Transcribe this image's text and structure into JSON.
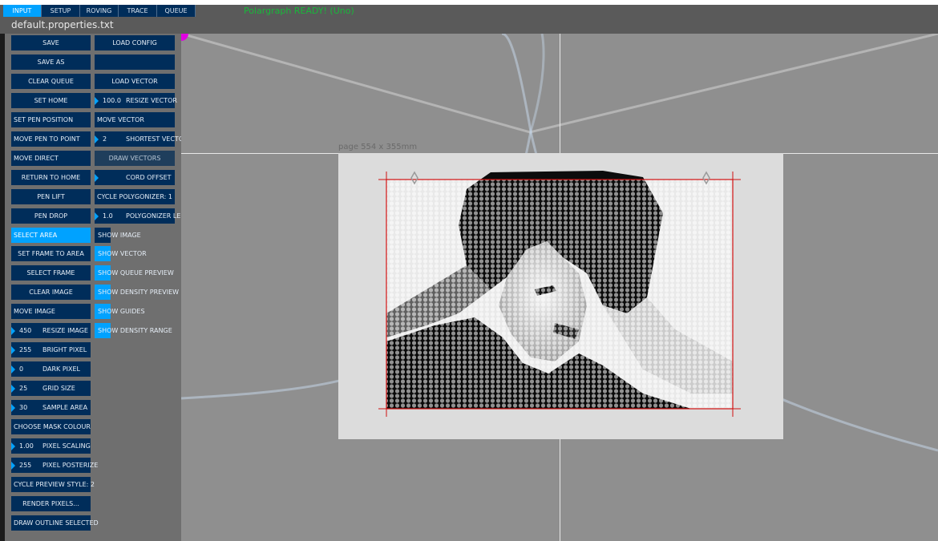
{
  "tabs": [
    {
      "label": "INPUT",
      "active": true
    },
    {
      "label": "SETUP",
      "active": false
    },
    {
      "label": "ROVING",
      "active": false
    },
    {
      "label": "TRACE",
      "active": false
    },
    {
      "label": "QUEUE",
      "active": false
    }
  ],
  "status_text": "Polargraph READY! (Uno)",
  "filename": "default.properties.txt",
  "page_label": "page 554 x 355mm",
  "colors": {
    "button_bg": "#002d5a",
    "button_selected_bg": "#00a2ff",
    "panel_bg": "#6f6f6f",
    "canvas_bg": "#8f8f8f",
    "page_bg": "#dcdcdc",
    "frame_red": "#d01010",
    "status_green": "#18b83a",
    "pin_magenta": "#e000e0"
  },
  "left_buttons": [
    {
      "label": "SAVE"
    },
    {
      "label": "SAVE AS"
    },
    {
      "label": "CLEAR QUEUE"
    },
    {
      "label": "SET HOME"
    },
    {
      "label": "SET PEN POSITION"
    },
    {
      "label": "MOVE PEN TO POINT"
    },
    {
      "label": "MOVE DIRECT"
    },
    {
      "label": "RETURN TO HOME"
    },
    {
      "label": "PEN LIFT"
    },
    {
      "label": "PEN DROP"
    },
    {
      "label": "SELECT AREA",
      "selected": true
    },
    {
      "label": "SET FRAME TO AREA"
    },
    {
      "label": "SELECT FRAME"
    },
    {
      "label": "CLEAR IMAGE"
    },
    {
      "label": "MOVE IMAGE"
    },
    {
      "label": "RESIZE IMAGE",
      "value": "450"
    },
    {
      "label": "BRIGHT PIXEL",
      "value": "255"
    },
    {
      "label": "DARK PIXEL",
      "value": "0"
    },
    {
      "label": "GRID SIZE",
      "value": "25"
    },
    {
      "label": "SAMPLE AREA",
      "value": "30"
    },
    {
      "label": "CHOOSE MASK COLOUR"
    },
    {
      "label": "PIXEL SCALING",
      "value": "1.00"
    },
    {
      "label": "PIXEL POSTERIZE",
      "value": "255"
    },
    {
      "label": "CYCLE PREVIEW STYLE: 2"
    },
    {
      "label": "RENDER PIXELS..."
    },
    {
      "label": "DRAW OUTLINE SELECTED"
    }
  ],
  "right_buttons": [
    {
      "label": "LOAD CONFIG"
    },
    {
      "label": ""
    },
    {
      "label": "LOAD VECTOR"
    },
    {
      "label": "RESIZE VECTOR",
      "value": "100.0"
    },
    {
      "label": "MOVE VECTOR"
    },
    {
      "label": "SHORTEST VECTOR",
      "value": "2"
    },
    {
      "label": "DRAW VECTORS",
      "dim": true
    },
    {
      "label": "CORD OFFSET",
      "value": ""
    },
    {
      "label": "CYCLE POLYGONIZER: 1"
    },
    {
      "label": "POLYGONIZER LENGTH",
      "value": "1.0"
    }
  ],
  "toggles": [
    {
      "label": "SHOW IMAGE",
      "on": false
    },
    {
      "label": "SHOW VECTOR",
      "on": true
    },
    {
      "label": "SHOW QUEUE PREVIEW",
      "on": true
    },
    {
      "label": "SHOW DENSITY PREVIEW",
      "on": true
    },
    {
      "label": "SHOW GUIDES",
      "on": true
    },
    {
      "label": "SHOW DENSITY RANGE",
      "on": true
    }
  ]
}
